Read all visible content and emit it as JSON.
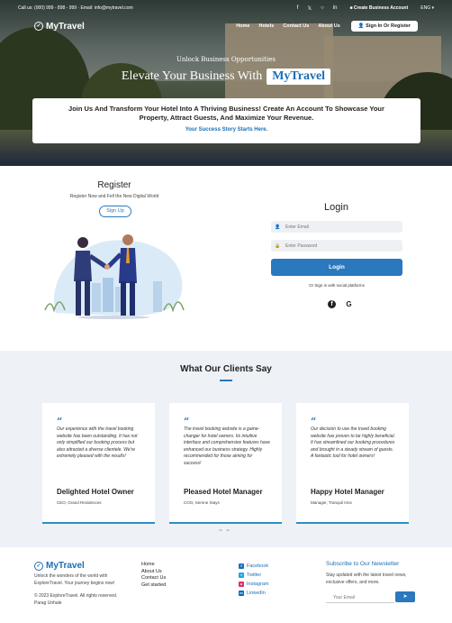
{
  "topbar": {
    "contact": "Call us: (000) 999 - 898 - 999  ·  Email: info@mytravel.com",
    "social_icons": [
      "facebook-icon",
      "twitter-icon",
      "instagram-icon",
      "linkedin-icon"
    ],
    "create_account": "Create Business Account",
    "language": "ENG ▾"
  },
  "nav": {
    "brand": "MyTravel",
    "links": [
      "Home",
      "Hotels",
      "Contact Us",
      "About Us"
    ],
    "signin": "Sign In Or Register"
  },
  "hero": {
    "subtitle": "Unlock Business Opportunities",
    "title": "Elevate Your Business With",
    "brand": "MyTravel",
    "card_text": "Join Us And Transform Your Hotel Into A Thriving Business! Create An Account To Showcase Your Property, Attract Guests, And Maximize Your Revenue.",
    "card_link": "Your Success Story Starts Here."
  },
  "register": {
    "title": "Register",
    "subtitle": "Register Now and Fell the New Digital World",
    "button": "Sign Up"
  },
  "login": {
    "title": "Login",
    "email_placeholder": "Enter Email",
    "password_placeholder": "Enter Password",
    "button": "Login",
    "or_text": "Or Sign in with social platforms",
    "social": [
      "facebook-icon",
      "google-icon"
    ]
  },
  "testimonials": {
    "title": "What Our Clients Say",
    "items": [
      {
        "quote": "Our experience with the travel booking website has been outstanding. It has not only simplified our booking process but also attracted a diverse clientele. We're extremely pleased with the results!",
        "name": "Delighted Hotel Owner",
        "role": "CEO, Grand Residences"
      },
      {
        "quote": "The travel booking website is a game-changer for hotel owners. Its intuitive interface and comprehensive features have enhanced our business strategy. Highly recommended for those aiming for success!",
        "name": "Pleased Hotel Manager",
        "role": "COO, Serene Stays"
      },
      {
        "quote": "Our decision to use the travel booking website has proven to be highly beneficial. It has streamlined our booking procedures and brought in a steady stream of guests. A fantastic tool for hotel owners!",
        "name": "Happy Hotel Manager",
        "role": "Manager, Tranquil Inns"
      }
    ]
  },
  "footer": {
    "brand": "MyTravel",
    "description": "Unlock the wonders of the world with ExploreTravel. Your journey begins now!",
    "copyright": "© 2023 ExploreTravel. All rights reserved.",
    "author": "Parag Unhale",
    "links": [
      "Home",
      "About Us",
      "Contact Us",
      "Get started"
    ],
    "social": [
      {
        "label": "Facebook",
        "icon": "facebook-icon",
        "color": "#1b6fb6"
      },
      {
        "label": "Twitter",
        "icon": "twitter-icon",
        "color": "#1da1f2"
      },
      {
        "label": "Instagram",
        "icon": "instagram-icon",
        "color": "#d6336c"
      },
      {
        "label": "LinkedIn",
        "icon": "linkedin-icon",
        "color": "#0a66c2"
      }
    ],
    "newsletter_title": "Subscribe to Our Newsletter",
    "newsletter_desc": "Stay updated with the latest travel news, exclusive offers, and more.",
    "email_placeholder": "Your Email"
  },
  "colors": {
    "accent": "#2a78bd",
    "brand": "#1b6fb6",
    "testimonial_bg": "#eef2f7"
  }
}
